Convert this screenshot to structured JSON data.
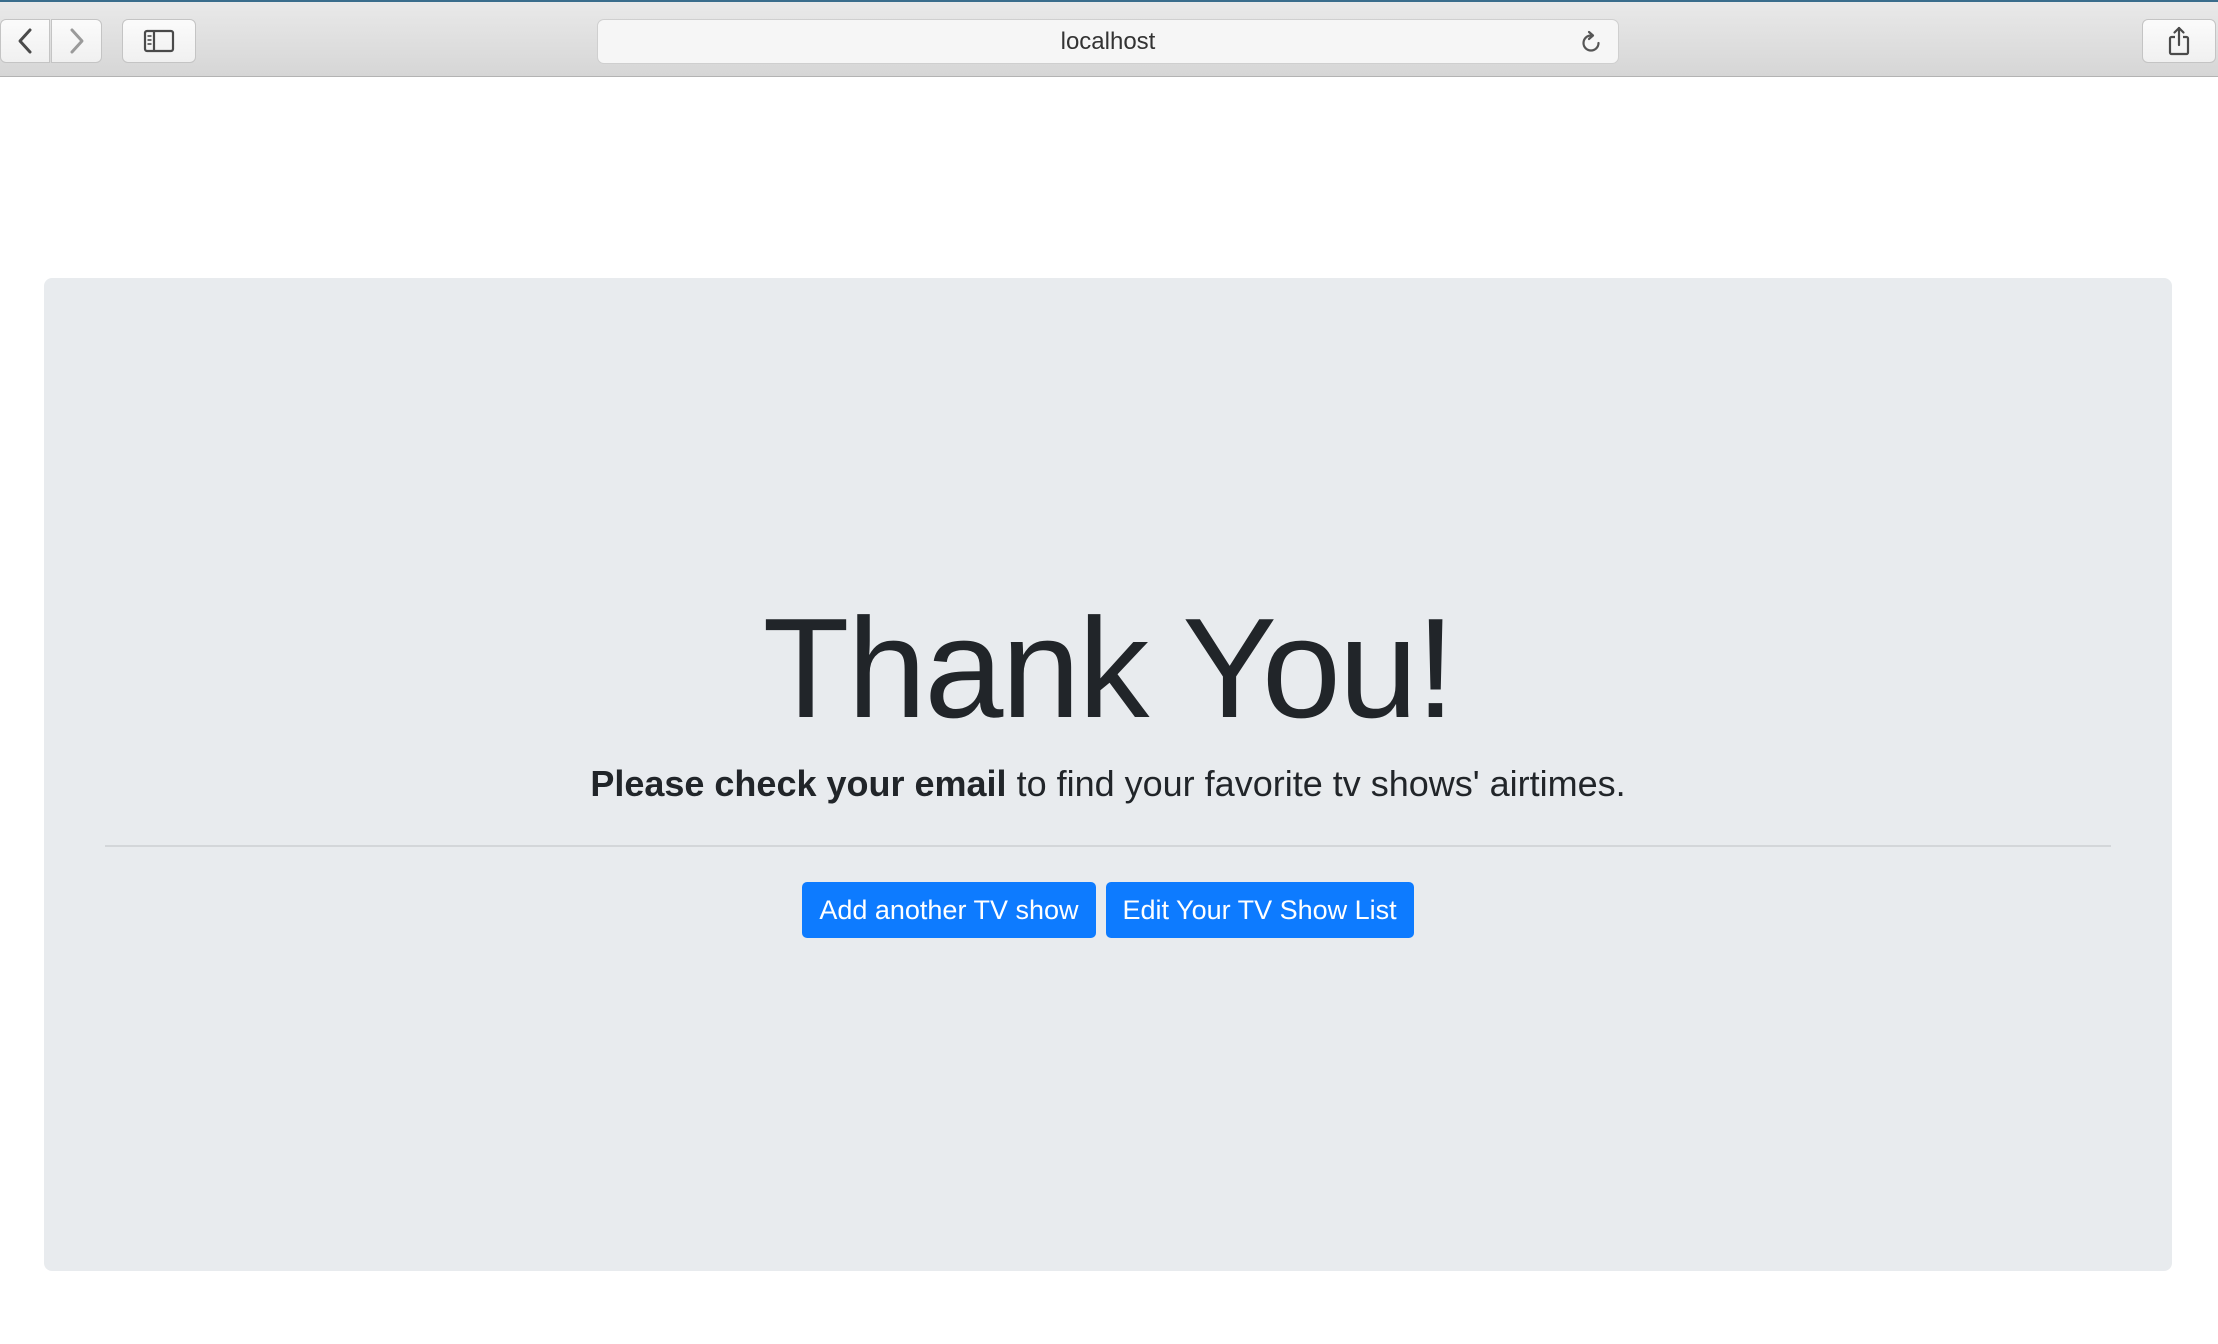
{
  "browser": {
    "address": "localhost"
  },
  "page": {
    "headline": "Thank You!",
    "lead_bold": "Please check your email",
    "lead_rest": " to find your favorite tv shows' airtimes.",
    "buttons": {
      "add_show": "Add another TV show",
      "edit_list": "Edit Your TV Show List"
    }
  },
  "colors": {
    "primary": "#0d7bff",
    "jumbotron_bg": "#e8ebee",
    "text": "#212529"
  },
  "icons": {
    "back": "chevron-left-icon",
    "forward": "chevron-right-icon",
    "sidebar": "sidebar-icon",
    "reload": "reload-icon",
    "share": "share-icon"
  }
}
